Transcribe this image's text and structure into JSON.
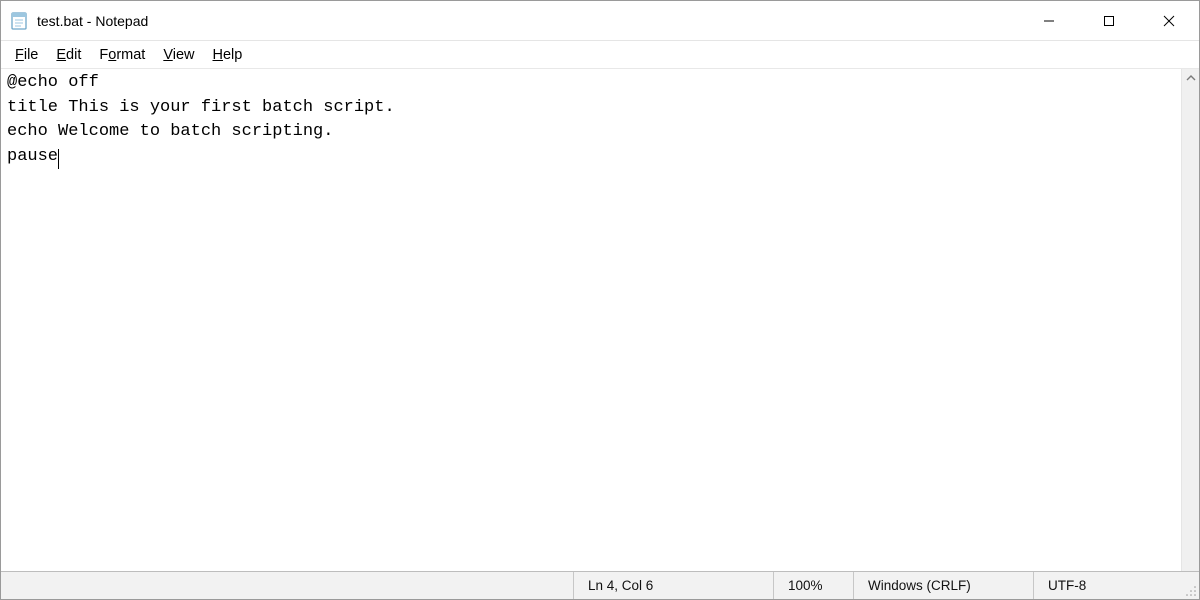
{
  "titlebar": {
    "title": "test.bat - Notepad"
  },
  "menu": {
    "file": {
      "text": "File",
      "ul_index": 0
    },
    "edit": {
      "text": "Edit",
      "ul_index": 0
    },
    "format": {
      "text": "Format",
      "ul_index": 1
    },
    "view": {
      "text": "View",
      "ul_index": 0
    },
    "help": {
      "text": "Help",
      "ul_index": 0
    }
  },
  "editor": {
    "lines": [
      "@echo off",
      "title This is your first batch script.",
      "echo Welcome to batch scripting.",
      "pause"
    ],
    "caret": {
      "line": 3,
      "col": 5
    }
  },
  "status": {
    "cursor": "Ln 4, Col 6",
    "zoom": "100%",
    "line_ending": "Windows (CRLF)",
    "encoding": "UTF-8"
  }
}
